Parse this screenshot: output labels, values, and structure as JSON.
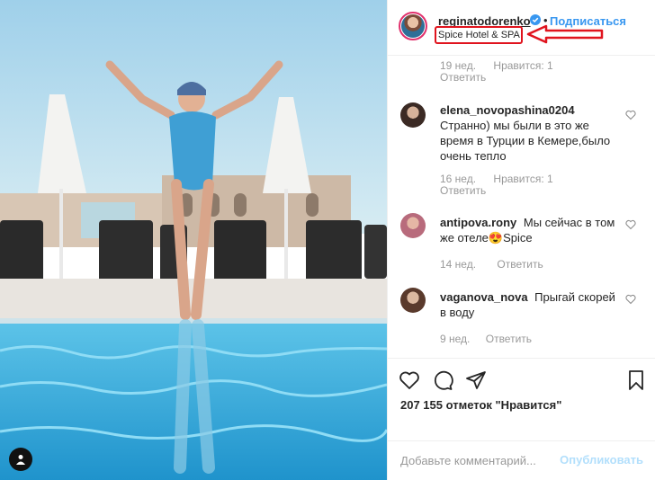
{
  "post": {
    "author": {
      "username": "reginatodorenko",
      "verified": true
    },
    "follow_label": "Подписаться",
    "dot": "•",
    "location": "Spice Hotel & SPA",
    "annotation_color": "#e0141e"
  },
  "comments": [
    {
      "username": "",
      "text": "",
      "age": "19 нед.",
      "likes": "Нравится: 1",
      "reply": "Ответить"
    },
    {
      "username": "elena_novopashina0204",
      "text": "Странно) мы были в это же время в Турции в Кемере,было очень тепло",
      "age": "16 нед.",
      "likes": "Нравится: 1",
      "reply": "Ответить"
    },
    {
      "username": "antipova.rony",
      "text": "Мы сейчас в том же отеле😍Spice",
      "age": "14 нед.",
      "reply": "Ответить"
    },
    {
      "username": "vaganova_nova",
      "text": "Прыгай скорей в воду",
      "age": "9 нед.",
      "reply": "Ответить"
    }
  ],
  "actions": {
    "icons": [
      "heart-icon",
      "comment-icon",
      "share-icon",
      "bookmark-icon"
    ],
    "likes_text": "207 155 отметок \"Нравится\""
  },
  "add_comment": {
    "placeholder": "Добавьте комментарий...",
    "publish_label": "Опубликовать"
  },
  "colors": {
    "link_blue": "#3897f0",
    "pool": "#2aa3d8",
    "sky": "#bfe0ee"
  }
}
